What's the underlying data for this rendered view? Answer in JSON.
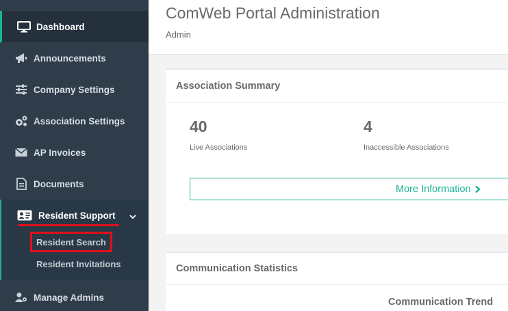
{
  "sidebar": {
    "items": [
      {
        "label": "Dashboard",
        "icon": "monitor-icon"
      },
      {
        "label": "Announcements",
        "icon": "megaphone-icon"
      },
      {
        "label": "Company Settings",
        "icon": "sliders-icon"
      },
      {
        "label": "Association Settings",
        "icon": "cogs-icon"
      },
      {
        "label": "AP Invoices",
        "icon": "envelope-icon"
      },
      {
        "label": "Documents",
        "icon": "document-icon"
      }
    ],
    "resident_support": {
      "label": "Resident Support",
      "icon": "id-card-icon",
      "subitems": [
        {
          "label": "Resident Search"
        },
        {
          "label": "Resident Invitations"
        }
      ]
    },
    "manage_admins": {
      "label": "Manage Admins",
      "icon": "user-cog-icon"
    }
  },
  "header": {
    "title": "ComWeb Portal Administration",
    "breadcrumb": "Admin"
  },
  "association_summary": {
    "title": "Association Summary",
    "stats": [
      {
        "value": "40",
        "label": "Live Associations"
      },
      {
        "value": "4",
        "label": "Inaccessible Associations"
      }
    ],
    "more_button": "More Information"
  },
  "communication_statistics": {
    "title": "Communication Statistics",
    "trend_title": "Communication Trend"
  },
  "colors": {
    "sidebar": "#2f3d4b",
    "accent": "#1ab394",
    "highlight": "#e0101a"
  }
}
